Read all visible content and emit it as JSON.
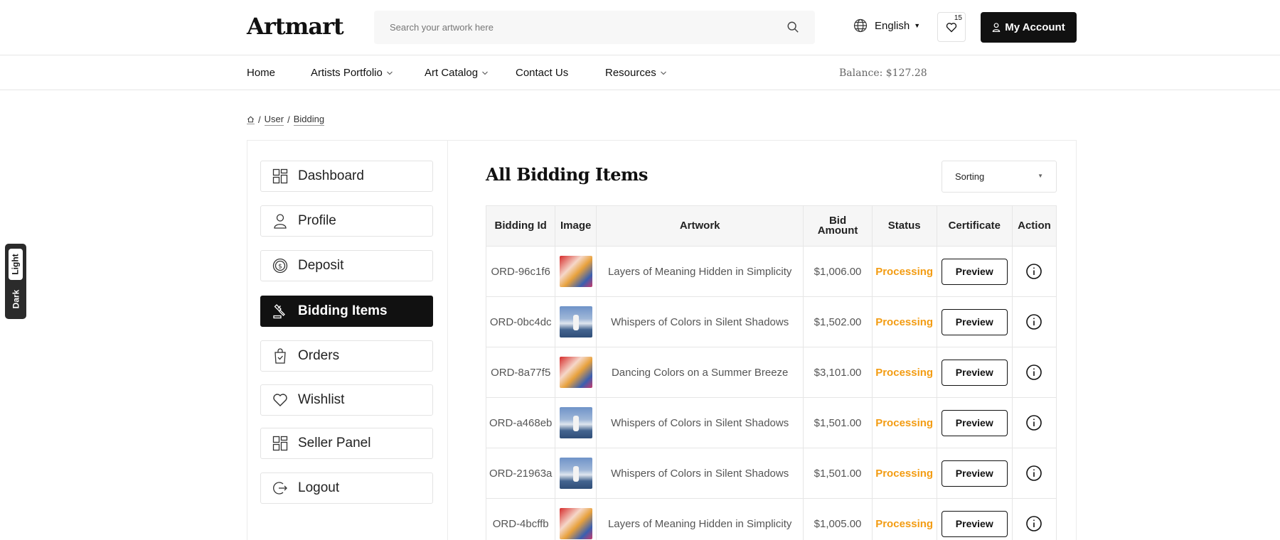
{
  "header": {
    "logo": "Artmart",
    "search_placeholder": "Search your artwork here",
    "language": "English",
    "wishlist_count": "15",
    "account_label": "My Account"
  },
  "nav": {
    "items": [
      {
        "label": "Home"
      },
      {
        "label": "Artists Portfolio"
      },
      {
        "label": "Art Catalog"
      },
      {
        "label": "Contact Us"
      },
      {
        "label": "Resources"
      }
    ],
    "balance": "Balance: $127.28"
  },
  "breadcrumb": {
    "user": "User",
    "current": "Bidding"
  },
  "sidebar": {
    "items": [
      {
        "label": "Dashboard",
        "icon": "dashboard-icon"
      },
      {
        "label": "Profile",
        "icon": "user-icon"
      },
      {
        "label": "Deposit",
        "icon": "dollar-icon"
      },
      {
        "label": "Bidding Items",
        "icon": "gavel-icon",
        "active": true
      },
      {
        "label": "Orders",
        "icon": "bag-icon"
      },
      {
        "label": "Wishlist",
        "icon": "heart-icon"
      },
      {
        "label": "Seller Panel",
        "icon": "dashboard-icon"
      },
      {
        "label": "Logout",
        "icon": "logout-icon"
      }
    ]
  },
  "main": {
    "title": "All Bidding Items",
    "sort_label": "Sorting",
    "columns": [
      "Bidding Id",
      "Image",
      "Artwork",
      "Bid Amount",
      "Status",
      "Certificate",
      "Action"
    ],
    "rows": [
      {
        "id": "ORD-96c1f6",
        "image": "warm",
        "artwork": "Layers of Meaning Hidden in Simplicity",
        "amount": "$1,006.00",
        "status": "Processing",
        "certificate": "Preview"
      },
      {
        "id": "ORD-0bc4dc",
        "image": "cool",
        "artwork": "Whispers of Colors in Silent Shadows",
        "amount": "$1,502.00",
        "status": "Processing",
        "certificate": "Preview"
      },
      {
        "id": "ORD-8a77f5",
        "image": "warm",
        "artwork": "Dancing Colors on a Summer Breeze",
        "amount": "$3,101.00",
        "status": "Processing",
        "certificate": "Preview"
      },
      {
        "id": "ORD-a468eb",
        "image": "cool",
        "artwork": "Whispers of Colors in Silent Shadows",
        "amount": "$1,501.00",
        "status": "Processing",
        "certificate": "Preview"
      },
      {
        "id": "ORD-21963a",
        "image": "cool",
        "artwork": "Whispers of Colors in Silent Shadows",
        "amount": "$1,501.00",
        "status": "Processing",
        "certificate": "Preview"
      },
      {
        "id": "ORD-4bcffb",
        "image": "warm",
        "artwork": "Layers of Meaning Hidden in Simplicity",
        "amount": "$1,005.00",
        "status": "Processing",
        "certificate": "Preview"
      }
    ]
  },
  "theme": {
    "light": "Light",
    "dark": "Dark"
  },
  "colors": {
    "accent": "#111111",
    "status_processing": "#f39c12"
  }
}
